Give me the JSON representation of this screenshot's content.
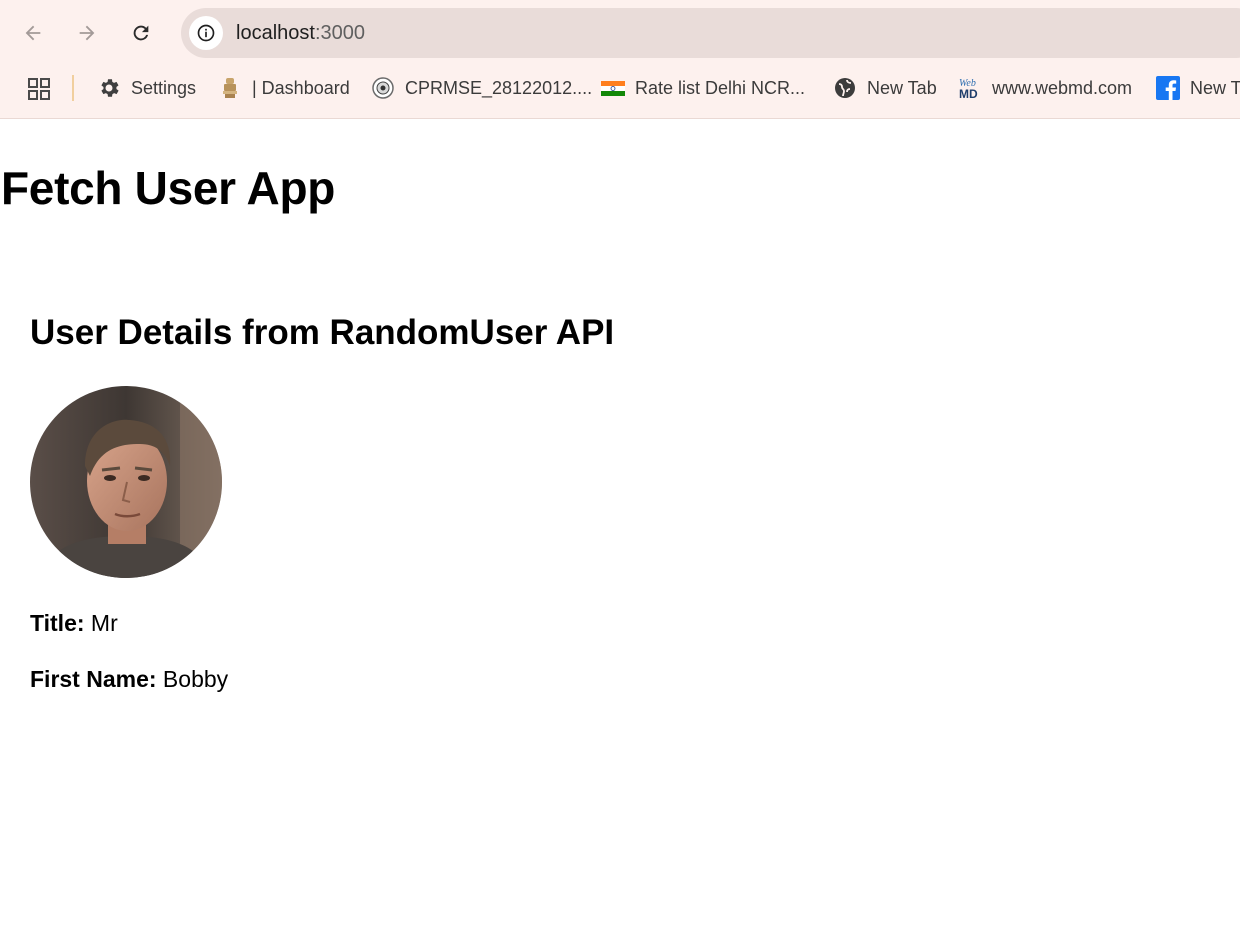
{
  "browser": {
    "url_host": "localhost",
    "url_port": ":3000",
    "bookmarks": [
      {
        "label": "Settings",
        "icon": "gear-icon"
      },
      {
        "label": "| Dashboard",
        "icon": "emblem-icon"
      },
      {
        "label": "CPRMSE_28122012....",
        "icon": "seal-icon"
      },
      {
        "label": "Rate list Delhi NCR...",
        "icon": "india-flag-icon"
      },
      {
        "label": "New Tab",
        "icon": "globe-icon"
      },
      {
        "label": "www.webmd.com",
        "icon": "webmd-icon"
      },
      {
        "label": "New Tab",
        "icon": "facebook-icon"
      }
    ]
  },
  "page": {
    "title": "Fetch User App",
    "card": {
      "heading": "User Details from RandomUser API",
      "fields": [
        {
          "label": "Title:",
          "value": " Mr"
        },
        {
          "label": "First Name:",
          "value": " Bobby"
        }
      ]
    }
  },
  "colors": {
    "chrome_bg": "#fdf1ee",
    "omnibox_bg": "#e9dcd9",
    "facebook_blue": "#1877f2"
  }
}
